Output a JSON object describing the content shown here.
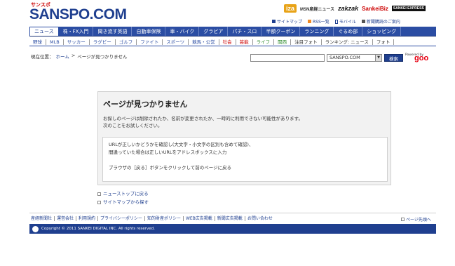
{
  "header": {
    "logo_small": "サンスポ",
    "logo": "SANSPO.COM",
    "partners": [
      "iza",
      "MSN産経ニュース",
      "zakzak",
      "SankeiBiz",
      "SANKEI EXPRESS"
    ]
  },
  "util_links": [
    "サイトマップ",
    "RSS一覧",
    "モバイル",
    "新聞購読のご案内"
  ],
  "nav_main": [
    "ニュース",
    "株・FX入門",
    "聞き流す英語",
    "自動車保険",
    "車・バイク",
    "グラビア",
    "パチ・スロ",
    "半額クーポン",
    "ランニング",
    "ぐるめ部",
    "ショッピング"
  ],
  "nav_sub": [
    {
      "label": "野球",
      "color": "#2b4da3"
    },
    {
      "label": "MLB",
      "color": "#2b4da3"
    },
    {
      "label": "サッカー",
      "color": "#2b4da3"
    },
    {
      "label": "ラグビー",
      "color": "#2b4da3"
    },
    {
      "label": "ゴルフ",
      "color": "#2b4da3"
    },
    {
      "label": "ファイト",
      "color": "#2b4da3"
    },
    {
      "label": "スポーツ",
      "color": "#2b4da3"
    },
    {
      "label": "競馬・公営",
      "color": "#2b4da3"
    },
    {
      "label": "社会",
      "color": "#cc0000"
    },
    {
      "label": "芸能",
      "color": "#cc0000"
    },
    {
      "label": "ライフ",
      "color": "#2e8b2e"
    },
    {
      "label": "関西",
      "color": "#2e8b2e"
    },
    {
      "label": "注目フォト",
      "color": "#333333"
    },
    {
      "label": "ランキング: ニュース",
      "color": "#333333"
    },
    {
      "label": "フォト",
      "color": "#333333"
    }
  ],
  "breadcrumb": {
    "prefix": "現在位置：",
    "home": "ホーム",
    "sep": ">",
    "current": "ページが見つかりません"
  },
  "search": {
    "value": "",
    "select_value": "SANSPO.COM",
    "button": "検索",
    "powered": "Powered by",
    "goo": "goo"
  },
  "error": {
    "title": "ページが見つかりません",
    "desc_line1": "お探しのページは削除されたか、名前が変更されたか、一時的に利用できない可能性があります。",
    "desc_line2": "次のことをお試しください。",
    "tip1_line1": "URLが正しいかどうかを確認し(大文字・小文字の区別も含めて確認)、",
    "tip1_line2": "間違っていた場合は正しいURLをアドレスボックスに入力",
    "tip2": "ブラウザの［戻る］ボタンをクリックして前のページに戻る"
  },
  "links": [
    "ニューストップに戻る",
    "サイトマップから探す"
  ],
  "footer": {
    "links": [
      "産経新聞社",
      "運営会社",
      "利用規約",
      "プライバシーポリシー",
      "知的財産ポリシー",
      "WEB広告掲載",
      "新聞広告掲載",
      "お問い合わせ"
    ],
    "back_to_top": "ページ先頭へ",
    "copyright": "Copyright © 2011 SANKEI DIGITAL INC. All rights reserved."
  },
  "colors": {
    "brand": "#1f3f8f",
    "nav": "#2b4da3"
  }
}
